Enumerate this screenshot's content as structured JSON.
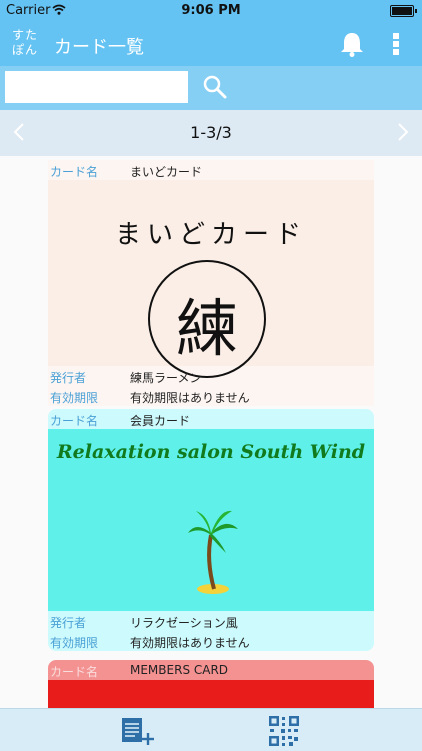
{
  "status_bar": {
    "carrier": "Carrier",
    "time": "9:06 PM"
  },
  "header": {
    "logo_line1": "すた",
    "logo_line2": "ぽん",
    "title": "カード一覧",
    "bell_icon": "bell-icon",
    "menu_icon": "more-vertical-icon"
  },
  "search": {
    "value": "",
    "placeholder": "",
    "button_icon": "search-icon"
  },
  "pager": {
    "range": "1-3/3",
    "prev_icon": "chevron-left-icon",
    "next_icon": "chevron-right-icon"
  },
  "cards": [
    {
      "name_label": "カード名",
      "name": "まいどカード",
      "image_title": "まいどカード",
      "image_seal": "練",
      "issuer_label": "発行者",
      "issuer": "練馬ラーメン",
      "expiry_label": "有効期限",
      "expiry": "有効期限はありません"
    },
    {
      "name_label": "カード名",
      "name": "会員カード",
      "image_title": "Relaxation salon South Wind",
      "image_icon": "palm-tree-icon",
      "issuer_label": "発行者",
      "issuer": "リラクゼーション風",
      "expiry_label": "有効期限",
      "expiry": "有効期限はありません"
    },
    {
      "name_label": "カード名",
      "name": "MEMBERS CARD"
    }
  ],
  "tab_bar": {
    "add_icon": "add-card-icon",
    "qr_icon": "qr-code-icon"
  },
  "colors": {
    "nav": "#64c3f2",
    "search_bar": "#86cff4",
    "pager": "#dde9f3",
    "label_blue": "#4aa0d6",
    "card2_bg": "#5ff0ea",
    "card3_bg": "#e91c1c"
  }
}
